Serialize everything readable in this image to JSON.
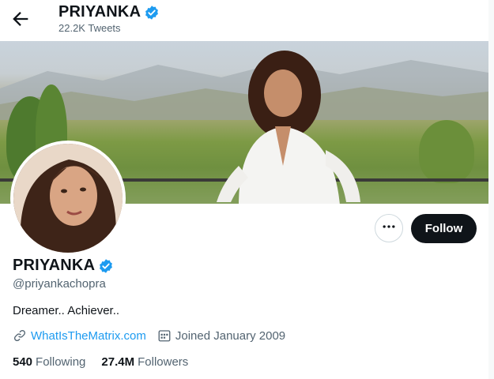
{
  "header": {
    "name": "PRIYANKA",
    "tweets_count": "22.2K Tweets"
  },
  "profile": {
    "name": "PRIYANKA",
    "handle": "@priyankachopra",
    "bio": "Dreamer.. Achiever..",
    "website": "WhatIsTheMatrix.com",
    "joined": "Joined January 2009",
    "following_count": "540",
    "following_label": "Following",
    "followers_count": "27.4M",
    "followers_label": "Followers"
  },
  "actions": {
    "follow_label": "Follow"
  },
  "icons": {
    "back": "back-arrow-icon",
    "verified": "verified-badge-icon",
    "more": "more-icon",
    "link": "link-icon",
    "calendar": "calendar-icon"
  },
  "colors": {
    "accent": "#1d9bf0",
    "follow_bg": "#0f1419",
    "secondary_text": "#536471"
  }
}
